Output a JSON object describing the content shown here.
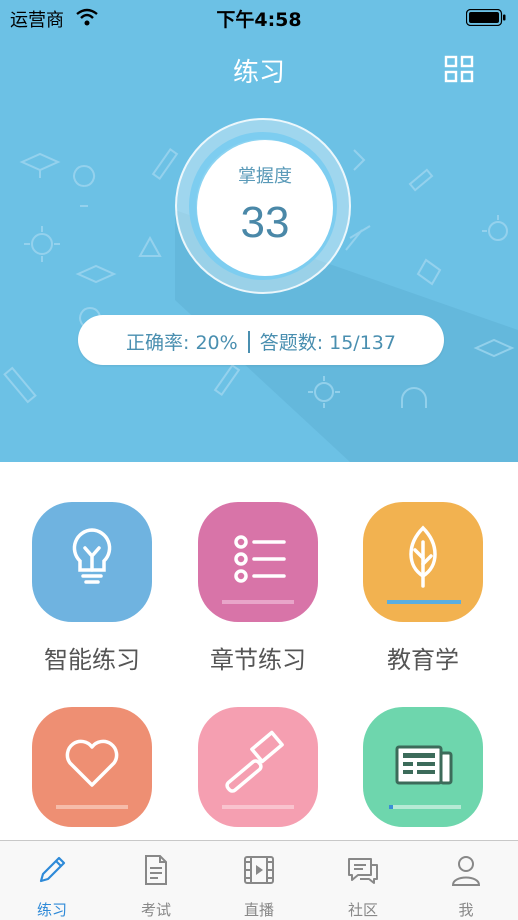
{
  "status_bar": {
    "carrier": "运营商",
    "time": "下午4:58"
  },
  "header": {
    "title": "练习"
  },
  "mastery": {
    "label": "掌握度",
    "value": "33"
  },
  "stats": {
    "accuracy": "正确率: 20%",
    "answered": "答题数: 15/137"
  },
  "modules": [
    {
      "label": "智能练习",
      "icon": "lightbulb-icon",
      "color": "#6fb3e0"
    },
    {
      "label": "章节练习",
      "icon": "list-icon",
      "color": "#d874a8"
    },
    {
      "label": "教育学",
      "icon": "leaf-icon",
      "color": "#f2b250"
    },
    {
      "label": "",
      "icon": "heart-icon",
      "color": "#ee8f73"
    },
    {
      "label": "",
      "icon": "gavel-icon",
      "color": "#f59fb1"
    },
    {
      "label": "",
      "icon": "newspaper-icon",
      "color": "#6ed6ad"
    }
  ],
  "tabs": [
    {
      "label": "练习",
      "icon": "pencil-icon",
      "active": true
    },
    {
      "label": "考试",
      "icon": "document-icon"
    },
    {
      "label": "直播",
      "icon": "film-icon"
    },
    {
      "label": "社区",
      "icon": "chat-icon"
    },
    {
      "label": "我",
      "icon": "person-icon"
    }
  ],
  "colors": {
    "header_bg": "#6cc1e5",
    "tab_active": "#2e8ad8",
    "tab_inactive": "#888888"
  }
}
